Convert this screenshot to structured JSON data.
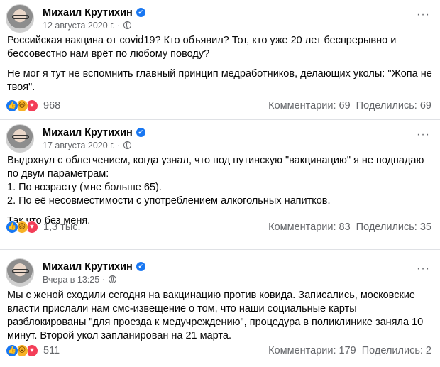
{
  "posts": [
    {
      "author": "Михаил Крутихин",
      "time": "12 августа 2020 г. ·",
      "paragraphs": [
        "Российская вакцина от covid19? Кто объявил? Тот, кто уже 20 лет беспрерывно и бессовестно нам врёт по любому поводу?",
        "Не мог я тут не вспомнить главный принцип медработников, делающих уколы: \"Жопа не твоя\"."
      ],
      "reactions": [
        "like-icon",
        "haha-icon",
        "love-icon"
      ],
      "reaction_count": "968",
      "comments": "Комментарии: 69",
      "shares": "Поделились: 69"
    },
    {
      "author": "Михаил Крутихин",
      "time": "17 августа 2020 г. ·",
      "paragraphs": [
        "Выдохнул с облегчением, когда узнал, что под путинскую \"вакцинацию\" я не подпадаю по двум параметрам:",
        "1. По возрасту (мне больше 65).",
        "2. По её несовместимости с употреблением алкогольных напитков.",
        "Так что без меня."
      ],
      "reactions": [
        "like-icon",
        "haha-icon",
        "love-icon"
      ],
      "reaction_count": "1,3 тыс.",
      "comments": "Комментарии: 83",
      "shares": "Поделились: 35"
    },
    {
      "author": "Михаил Крутихин",
      "time": "Вчера в 13:25 ·",
      "paragraphs": [
        "Мы с женой сходили сегодня на вакцинацию против ковида. Записались, московские власти прислали нам смс-извещение о том, что наши социальные карты разблокированы \"для проезда к медучреждению\", процедура в поликлинике заняла 10 минут. Второй укол запланирован на 21 марта."
      ],
      "reactions": [
        "like-icon",
        "wow-icon",
        "love-icon"
      ],
      "reaction_count": "511",
      "comments": "Комментарии: 179",
      "shares": "Поделились: 2"
    }
  ],
  "icons": {
    "verified": "✔",
    "more": "···",
    "like": "👍",
    "haha": "😆",
    "wow": "😮",
    "love": "♥"
  },
  "colors": {
    "accent": "#1877f2",
    "meta": "#65676b",
    "love": "#f33e58",
    "emoji": "#f7b125"
  }
}
